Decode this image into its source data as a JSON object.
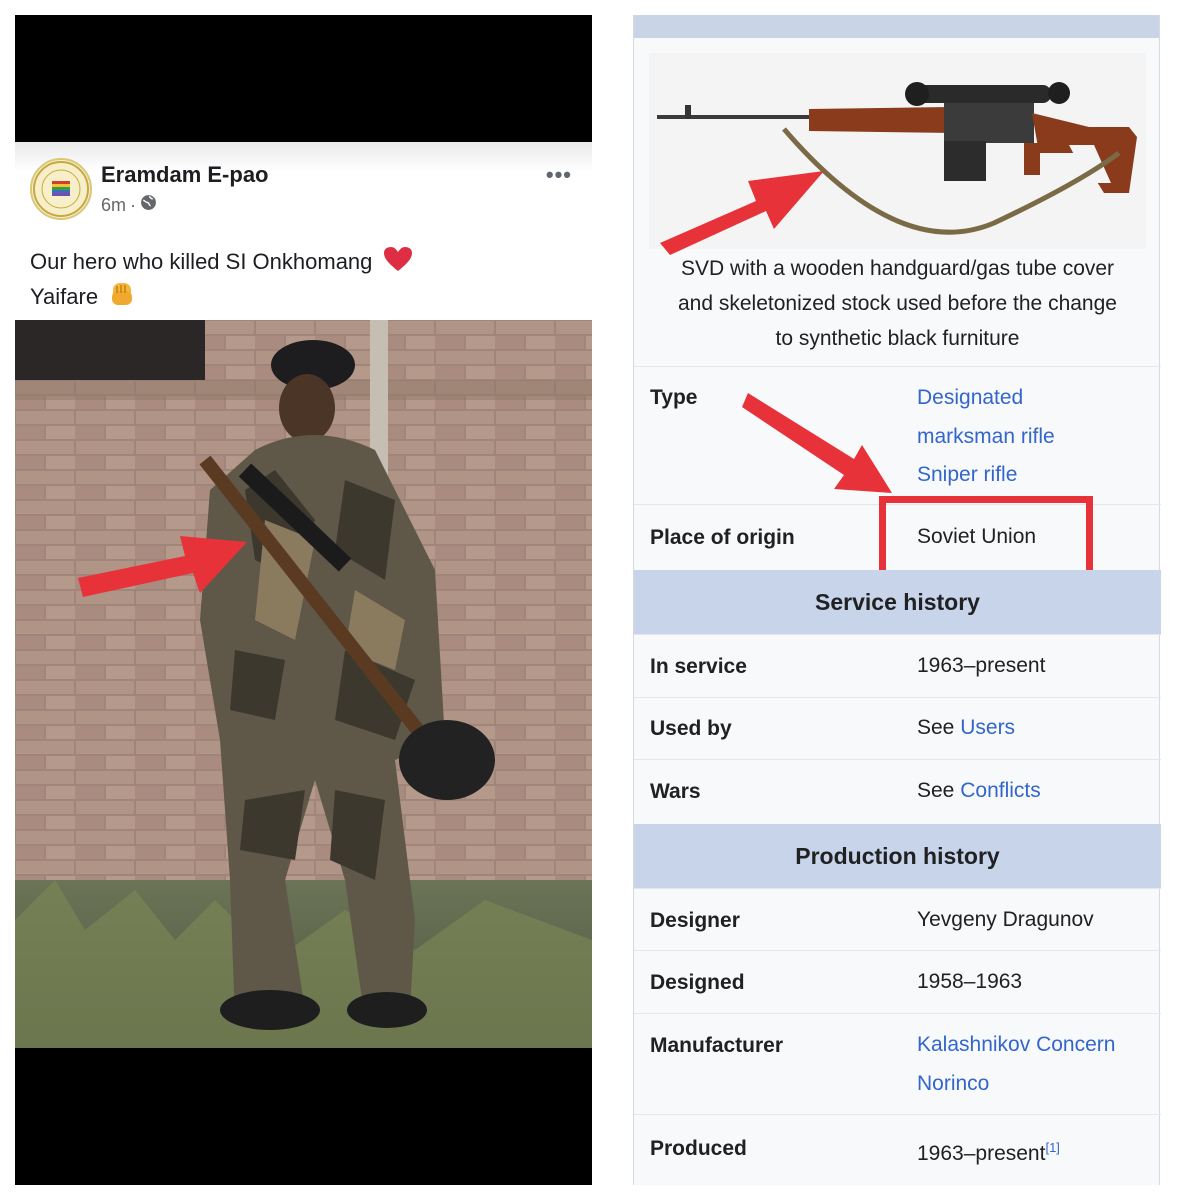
{
  "post": {
    "page_name": "Eramdam E-pao",
    "time": "6m",
    "separator": "·",
    "more": "•••",
    "text_line1": "Our hero who killed SI Onkhomang",
    "text_line2": "Yaifare",
    "icons": [
      "page-logo",
      "globe-icon",
      "heart-emoji",
      "fist-emoji",
      "more-icon"
    ]
  },
  "infobox": {
    "caption": [
      "SVD with a wooden handguard/gas tube cover",
      "and skeletonized stock used before the change",
      "to synthetic black furniture"
    ],
    "type": {
      "label": "Type",
      "values": [
        "Designated",
        "marksman rifle",
        "Sniper rifle"
      ]
    },
    "origin": {
      "label": "Place of origin",
      "value": "Soviet Union"
    },
    "service_history": {
      "title": "Service history",
      "rows": [
        {
          "label": "In service",
          "value": "1963–present"
        },
        {
          "label": "Used by",
          "prefix": "See",
          "link": "Users"
        },
        {
          "label": "Wars",
          "prefix": "See",
          "link": "Conflicts"
        }
      ]
    },
    "production_history": {
      "title": "Production history",
      "designer": {
        "label": "Designer",
        "value": "Yevgeny Dragunov"
      },
      "designed": {
        "label": "Designed",
        "value": "1958–1963"
      },
      "manufacturer": {
        "label": "Manufacturer",
        "values": [
          "Kalashnikov Concern",
          "Norinco"
        ]
      },
      "produced": {
        "label": "Produced",
        "value": "1963–present",
        "ref": "[1]"
      }
    }
  },
  "colors": {
    "annotation_red": "#e8323a",
    "wiki_link": "#3366cc",
    "section_header": "#c8d4ea"
  }
}
